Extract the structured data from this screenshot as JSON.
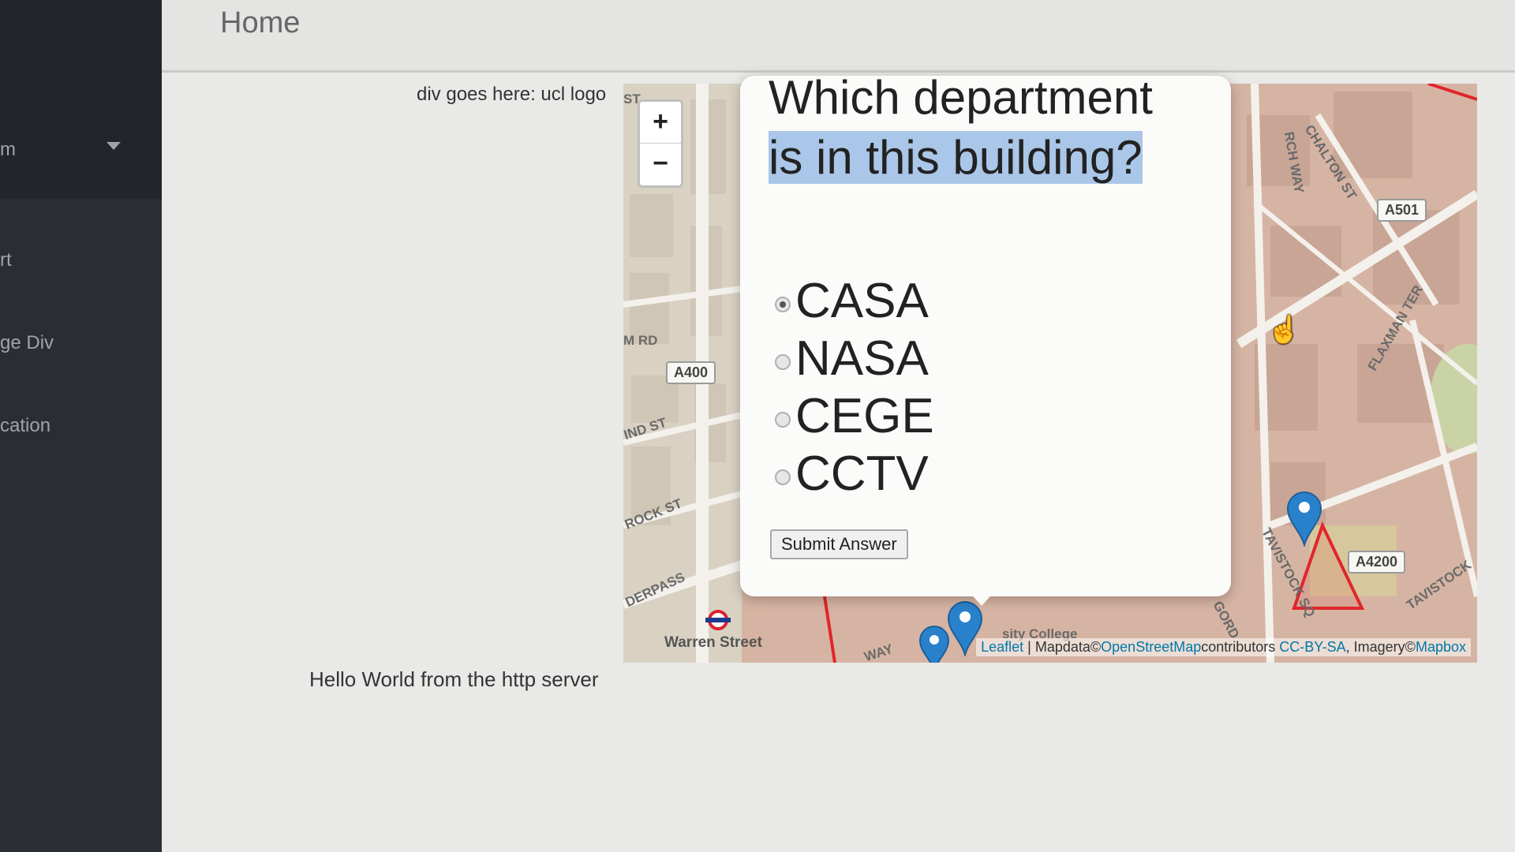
{
  "header": {
    "title": "Home"
  },
  "sidebar": {
    "items": [
      {
        "label": "m"
      },
      {
        "label": "rt"
      },
      {
        "label": "ge Div"
      },
      {
        "label": "cation"
      }
    ]
  },
  "content": {
    "logo_placeholder": "div goes here: ucl logo",
    "hello_text": "Hello World from the http server"
  },
  "map": {
    "zoom_in": "+",
    "zoom_out": "−",
    "labels": {
      "st": "ST",
      "m_rd": "M RD",
      "nd_st": "IND ST",
      "rock_st": "ROCK ST",
      "derpass": "DERPASS",
      "warren_street": "Warren Street",
      "church_way": "RCH WAY",
      "chalton_st": "CHALTON ST",
      "flaxman_ter": "FLAXMAN TER",
      "tavistock_sq": "TAVISTOCK SQ",
      "tavistock": "TAVISTOCK",
      "gordon": "GORD",
      "university_college": "sity College",
      "way": "WAY"
    },
    "road_shields": [
      "A400",
      "A501",
      "A4200"
    ],
    "attribution": {
      "leaflet": "Leaflet",
      "separator": " | Mapdata©",
      "osm": "OpenStreetMap",
      "contributors": "contributors",
      "license": "CC-BY-SA",
      "imagery": ", Imagery©",
      "mapbox": "Mapbox"
    }
  },
  "quiz": {
    "question_line1": "Which department",
    "question_line2": "is in this building?",
    "options": [
      "CASA",
      "NASA",
      "CEGE",
      "CCTV"
    ],
    "selected_option": "CASA",
    "submit_label": "Submit Answer"
  },
  "colors": {
    "sidebar_bg": "#2a2e33",
    "highlight": "#aac6e8",
    "marker_blue": "#2a81cb",
    "polygon_red": "#e0262b",
    "link": "#0078a8"
  }
}
